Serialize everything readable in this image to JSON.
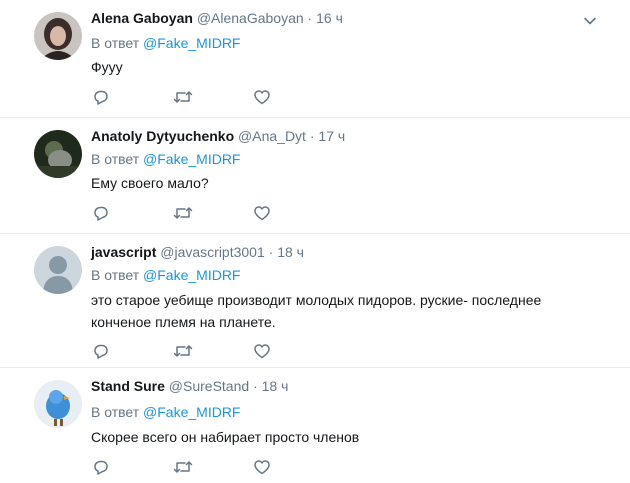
{
  "tweets": [
    {
      "name": "Alena Gaboyan",
      "handle": "@AlenaGaboyan",
      "sep": "·",
      "time": "16 ч",
      "reply_prefix": "В ответ",
      "reply_to": "@Fake_MIDRF",
      "text": "Фууу"
    },
    {
      "name": "Anatoly Dytyuchenko",
      "handle": "@Ana_Dyt",
      "sep": "·",
      "time": "17 ч",
      "reply_prefix": "В ответ",
      "reply_to": "@Fake_MIDRF",
      "text": "Ему своего мало?"
    },
    {
      "name": "javascript",
      "handle": "@javascript3001",
      "sep": "·",
      "time": "18 ч",
      "reply_prefix": "В ответ",
      "reply_to": "@Fake_MIDRF",
      "text_line1": "это старое уебище производит молодых пидоров. руские- последнее",
      "text_line2": "конченое племя на планете."
    },
    {
      "name": "Stand Sure",
      "handle": "@SureStand",
      "sep": "·",
      "time": "18 ч",
      "reply_prefix": "В ответ",
      "reply_to": "@Fake_MIDRF",
      "text": "Скорее всего он набирает просто членов"
    }
  ],
  "colors": {
    "link": "#1b95e0",
    "secondary": "#657786",
    "divider": "#e6ecf0",
    "icon": "#657786"
  },
  "icons": [
    "reply-icon",
    "retweet-icon",
    "like-icon",
    "caret-down-icon"
  ]
}
